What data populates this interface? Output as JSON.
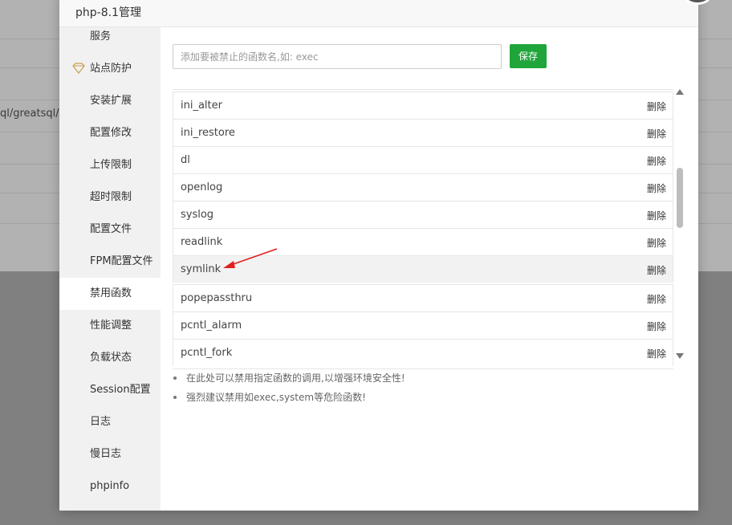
{
  "background": {
    "path_fragment": "ql/greatsql/m"
  },
  "dialog": {
    "title": "php-8.1管理"
  },
  "sidebar": {
    "items": [
      {
        "label": "服务",
        "icon": null
      },
      {
        "label": "站点防护",
        "icon": "diamond-icon"
      },
      {
        "label": "安装扩展",
        "icon": null
      },
      {
        "label": "配置修改",
        "icon": null
      },
      {
        "label": "上传限制",
        "icon": null
      },
      {
        "label": "超时限制",
        "icon": null
      },
      {
        "label": "配置文件",
        "icon": null
      },
      {
        "label": "FPM配置文件",
        "icon": null
      },
      {
        "label": "禁用函数",
        "icon": null,
        "active": true
      },
      {
        "label": "性能调整",
        "icon": null
      },
      {
        "label": "负载状态",
        "icon": null
      },
      {
        "label": "Session配置",
        "icon": null
      },
      {
        "label": "日志",
        "icon": null
      },
      {
        "label": "慢日志",
        "icon": null
      },
      {
        "label": "phpinfo",
        "icon": null
      }
    ]
  },
  "main": {
    "input": {
      "value": "",
      "placeholder": "添加要被禁止的函数名,如: exec"
    },
    "save_label": "保存",
    "delete_label": "删除",
    "functions": [
      "ini_alter",
      "ini_restore",
      "dl",
      "openlog",
      "syslog",
      "readlink",
      "symlink",
      "popepassthru",
      "pcntl_alarm",
      "pcntl_fork"
    ],
    "highlighted": "symlink",
    "tips": [
      "在此处可以禁用指定函数的调用,以增强环境安全性!",
      "强烈建议禁用如exec,system等危险函数!"
    ]
  },
  "colors": {
    "accent": "#20a53a",
    "annotation": "#e0201e",
    "sidebar_bg": "#f1f1f1"
  }
}
